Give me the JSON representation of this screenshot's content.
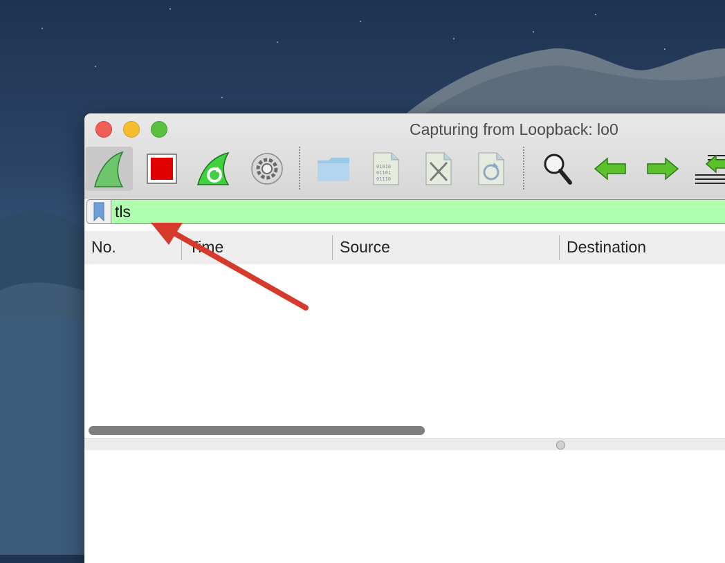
{
  "window": {
    "title": "Capturing from Loopback: lo0"
  },
  "toolbar": {
    "buttons": [
      {
        "name": "start-capture",
        "icon": "shark-fin-icon"
      },
      {
        "name": "stop-capture",
        "icon": "stop-square-icon"
      },
      {
        "name": "restart-capture",
        "icon": "shark-fin-restart-icon"
      },
      {
        "name": "capture-options",
        "icon": "gear-icon"
      },
      {
        "name": "open-file",
        "icon": "folder-icon"
      },
      {
        "name": "save-file",
        "icon": "binary-file-icon"
      },
      {
        "name": "close-file",
        "icon": "close-file-icon"
      },
      {
        "name": "reload-file",
        "icon": "reload-file-icon"
      },
      {
        "name": "find-packet",
        "icon": "magnifier-icon"
      },
      {
        "name": "go-back",
        "icon": "arrow-left-icon"
      },
      {
        "name": "go-forward",
        "icon": "arrow-right-icon"
      },
      {
        "name": "go-to-packet",
        "icon": "arrow-list-icon"
      }
    ]
  },
  "filter": {
    "value": "tls",
    "valid_color": "#afffaf"
  },
  "packet_list": {
    "columns": [
      "No.",
      "Time",
      "Source",
      "Destination"
    ]
  },
  "annotation": {
    "color": "#d63a2b"
  }
}
